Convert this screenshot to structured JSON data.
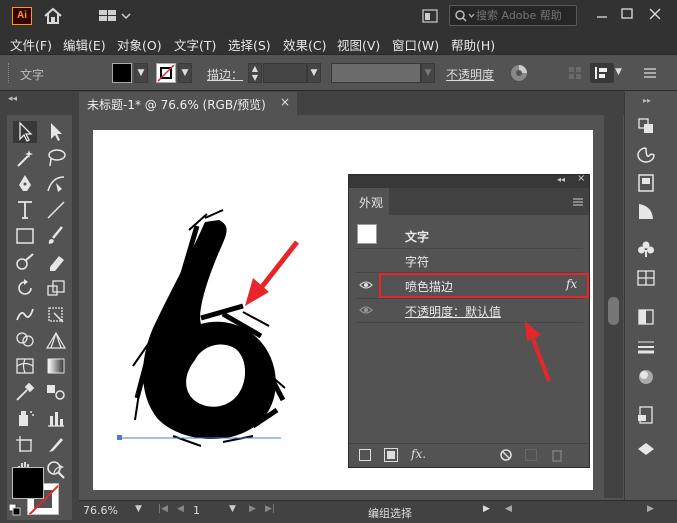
{
  "app": {
    "logo": "Ai",
    "search_placeholder": "搜索 Adobe 帮助"
  },
  "menu": [
    "文件(F)",
    "编辑(E)",
    "对象(O)",
    "文字(T)",
    "选择(S)",
    "效果(C)",
    "视图(V)",
    "窗口(W)",
    "帮助(H)"
  ],
  "control": {
    "selection_type": "文字",
    "stroke_label": "描边：",
    "opacity_label": "不透明度"
  },
  "document": {
    "tab_title": "未标题-1* @ 76.6% (RGB/预览)",
    "close": "×"
  },
  "appearance_panel": {
    "tab": "外观",
    "rows": [
      {
        "label": "文字"
      },
      {
        "label": "字符"
      },
      {
        "label": "喷色描边",
        "fx": "fx"
      },
      {
        "label": "不透明度：默认值"
      }
    ],
    "footer_fx": "fx."
  },
  "status": {
    "zoom": "76.6%",
    "page": "1",
    "tool_name": "编组选择"
  },
  "colors": {
    "highlight": "#e8262a",
    "artwork": "#000000",
    "baseline": "#4a7bd8"
  }
}
